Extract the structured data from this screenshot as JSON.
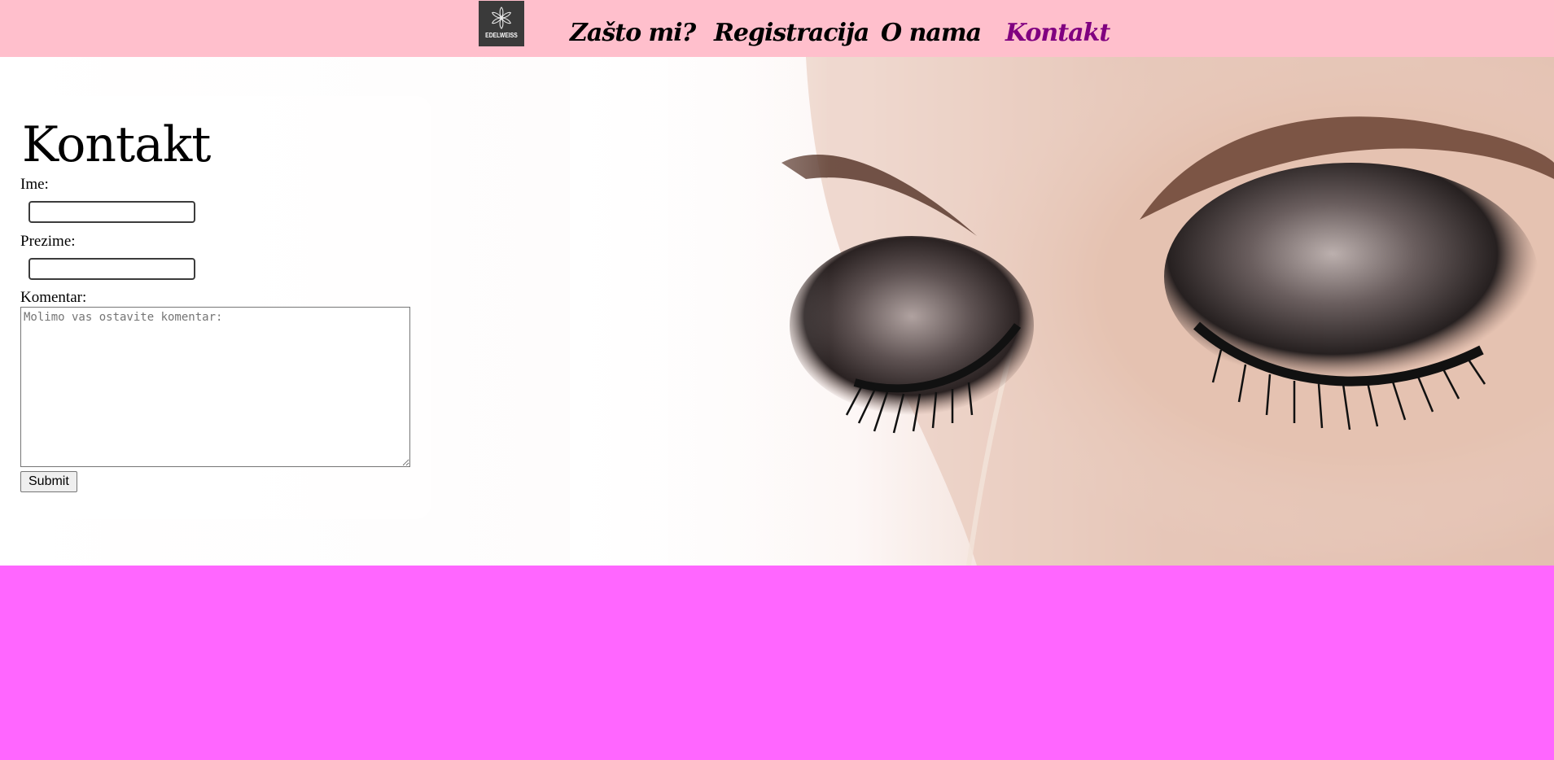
{
  "header": {
    "logo_text": "EDELWEISS",
    "nav": [
      {
        "label": "Zašto mi?"
      },
      {
        "label": "Registracija"
      },
      {
        "label": "O nama"
      },
      {
        "label": "Kontakt"
      }
    ]
  },
  "contact": {
    "title": "Kontakt",
    "ime_label": "Ime:",
    "ime_value": "",
    "prezime_label": "Prezime:",
    "prezime_value": "",
    "komentar_label": "Komentar:",
    "komentar_placeholder": "Molimo vas ostavite komentar:",
    "submit_label": "Submit"
  },
  "colors": {
    "topbar": "#ffbfcc",
    "footer": "#ff66ff",
    "active_nav": "#800080"
  },
  "icons": {
    "logo": "edelweiss-flower-icon"
  }
}
